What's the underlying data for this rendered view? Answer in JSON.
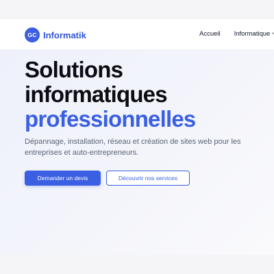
{
  "brand": {
    "badge": "GC",
    "name": "Informatik",
    "color": "#2f54d8"
  },
  "nav": {
    "items": [
      {
        "label": "Accueil"
      },
      {
        "label": "Informatique",
        "icon": "chevron-down-icon",
        "dropdown": true
      }
    ]
  },
  "hero": {
    "title_line1": "Solutions",
    "title_line2": "informatiques",
    "title_line3": "professionnelles",
    "accent_color": "#3a5fe3",
    "description": "Dépannage, installation, réseau et création de sites web pour les entreprises et auto-entrepreneurs.",
    "primary_cta": "Demander un devis",
    "secondary_cta": "Découvrir nos services"
  }
}
